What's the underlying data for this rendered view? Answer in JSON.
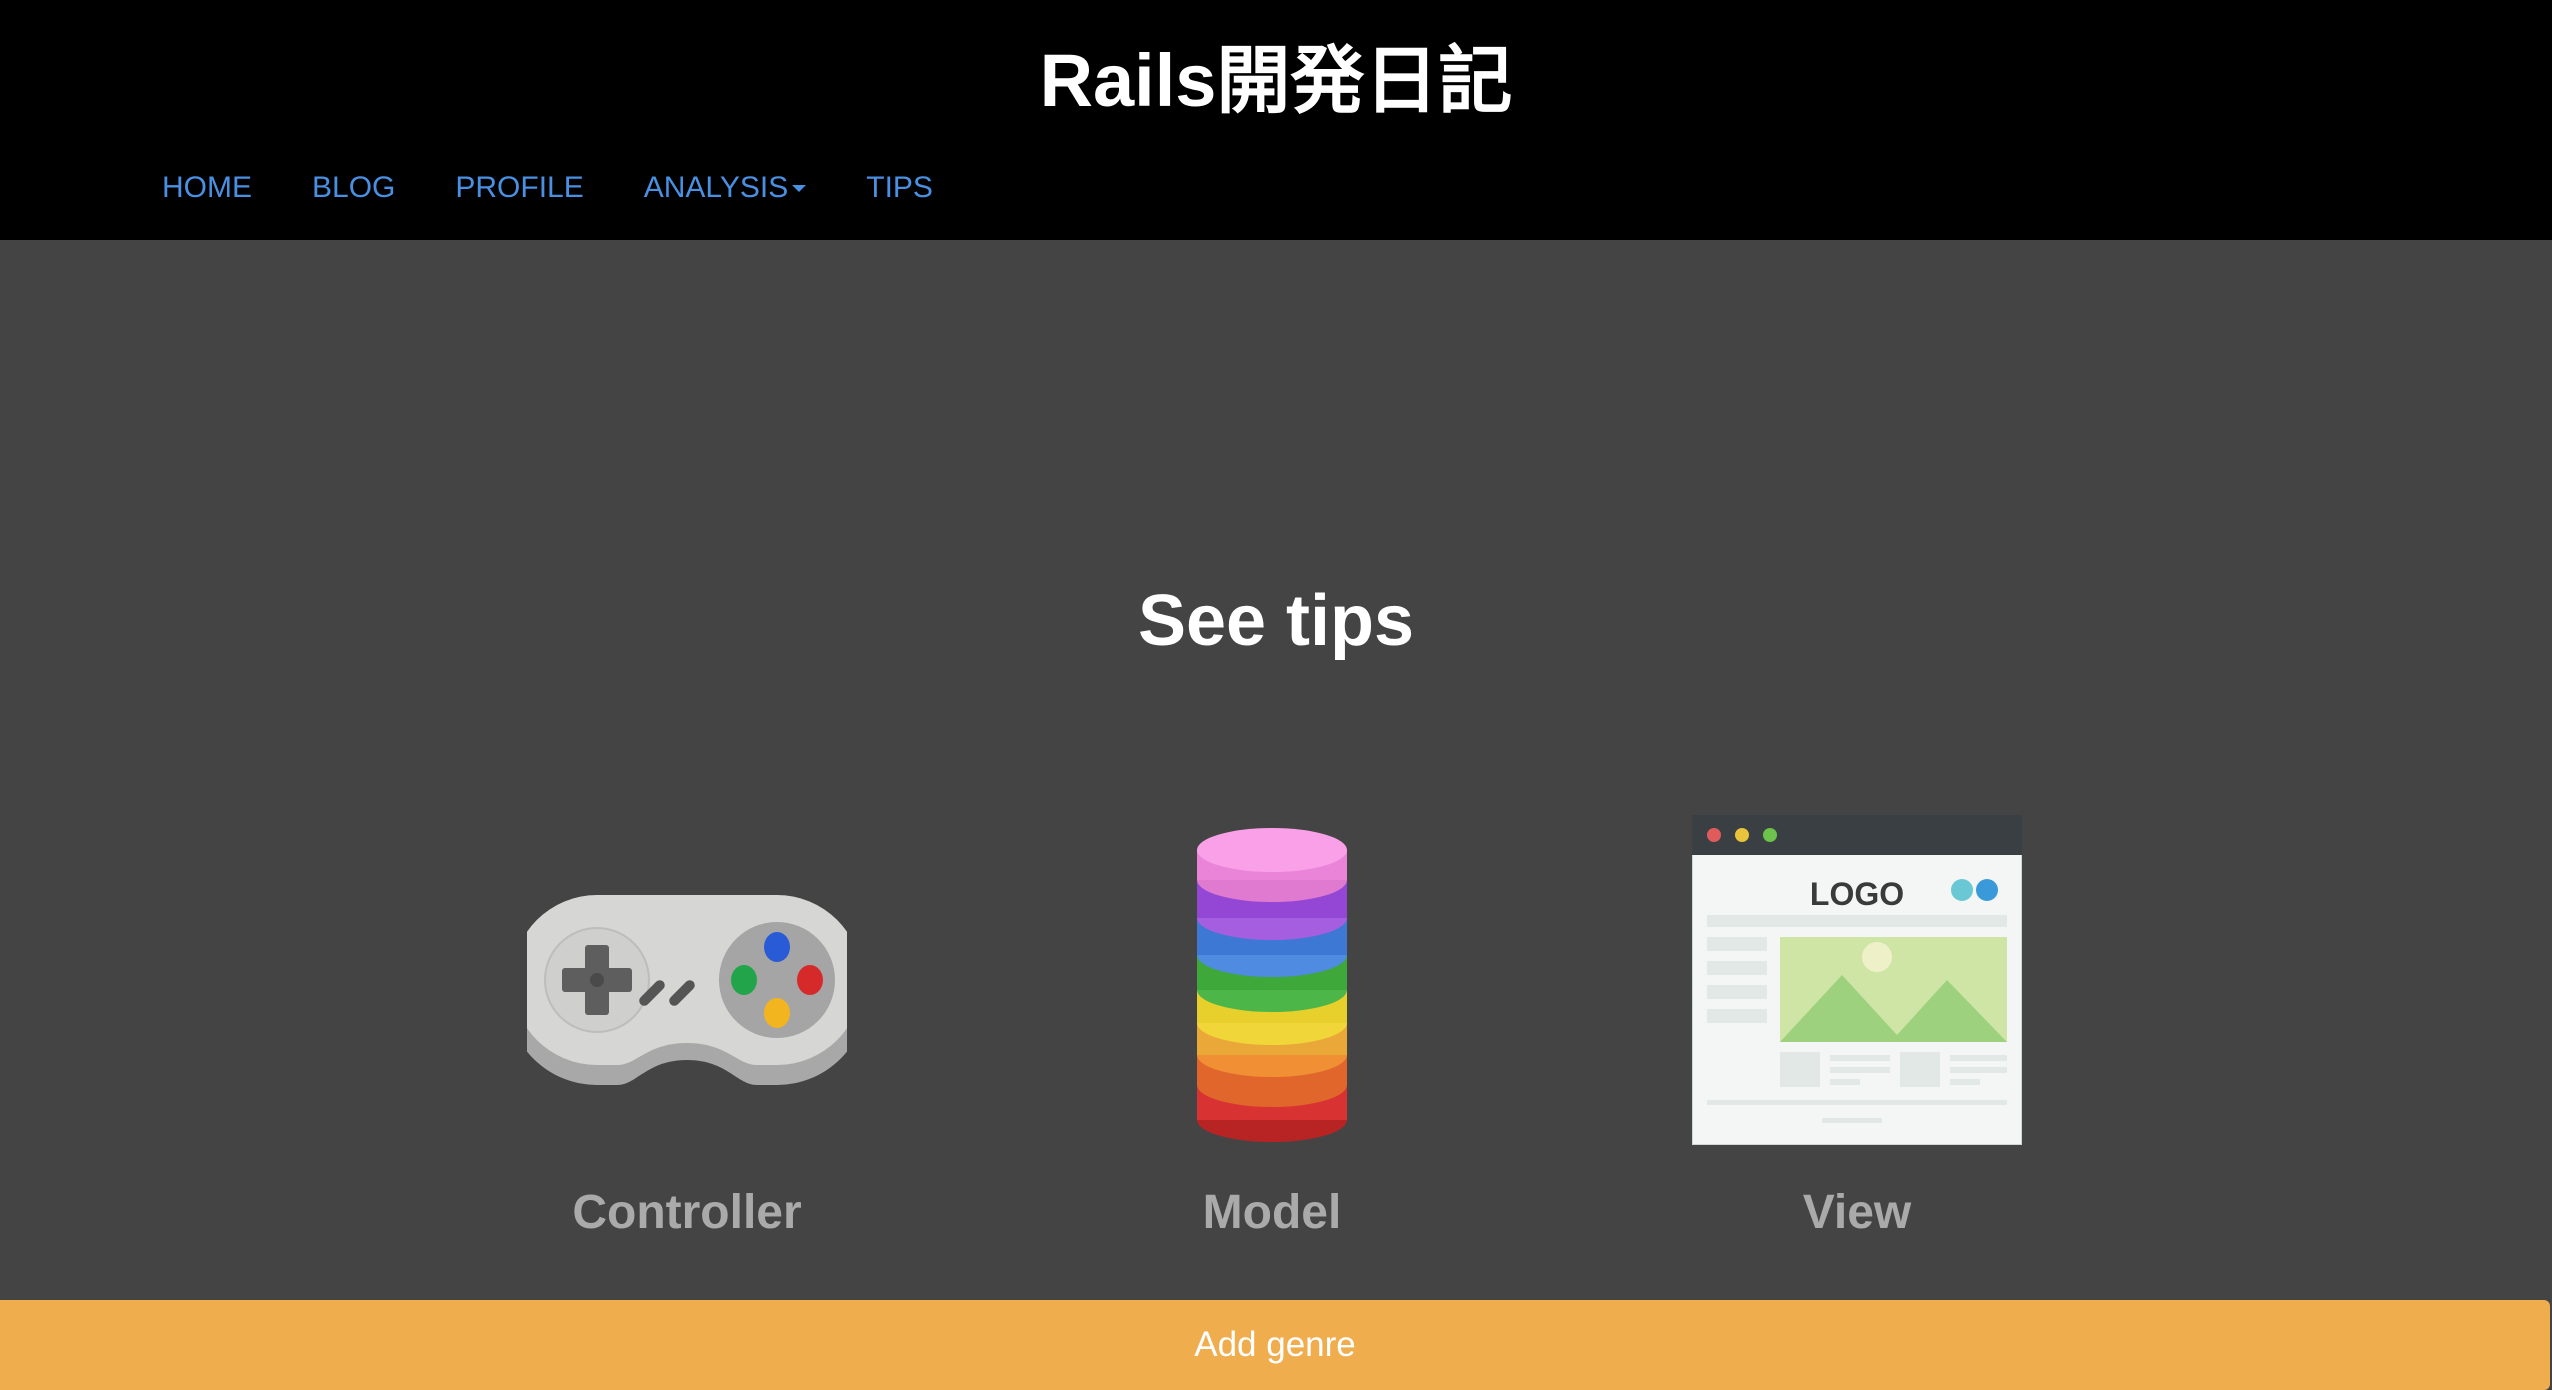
{
  "header": {
    "title": "Rails開発日記",
    "nav": [
      {
        "label": "HOME"
      },
      {
        "label": "BLOG"
      },
      {
        "label": "PROFILE"
      },
      {
        "label": "ANALYSIS",
        "dropdown": true
      },
      {
        "label": "TIPS"
      }
    ]
  },
  "main": {
    "heading": "See tips",
    "cards": [
      {
        "label": "Controller",
        "icon": "game-controller-icon"
      },
      {
        "label": "Model",
        "icon": "database-stack-icon"
      },
      {
        "label": "View",
        "icon": "webpage-mockup-icon"
      }
    ],
    "view_icon_logo_text": "LOGO"
  },
  "actions": {
    "add_genre_label": "Add genre"
  },
  "colors": {
    "header_bg": "#000000",
    "page_bg": "#444444",
    "nav_link": "#4a90e2",
    "card_label": "#aaaaaa",
    "add_button": "#f0ad4e"
  }
}
